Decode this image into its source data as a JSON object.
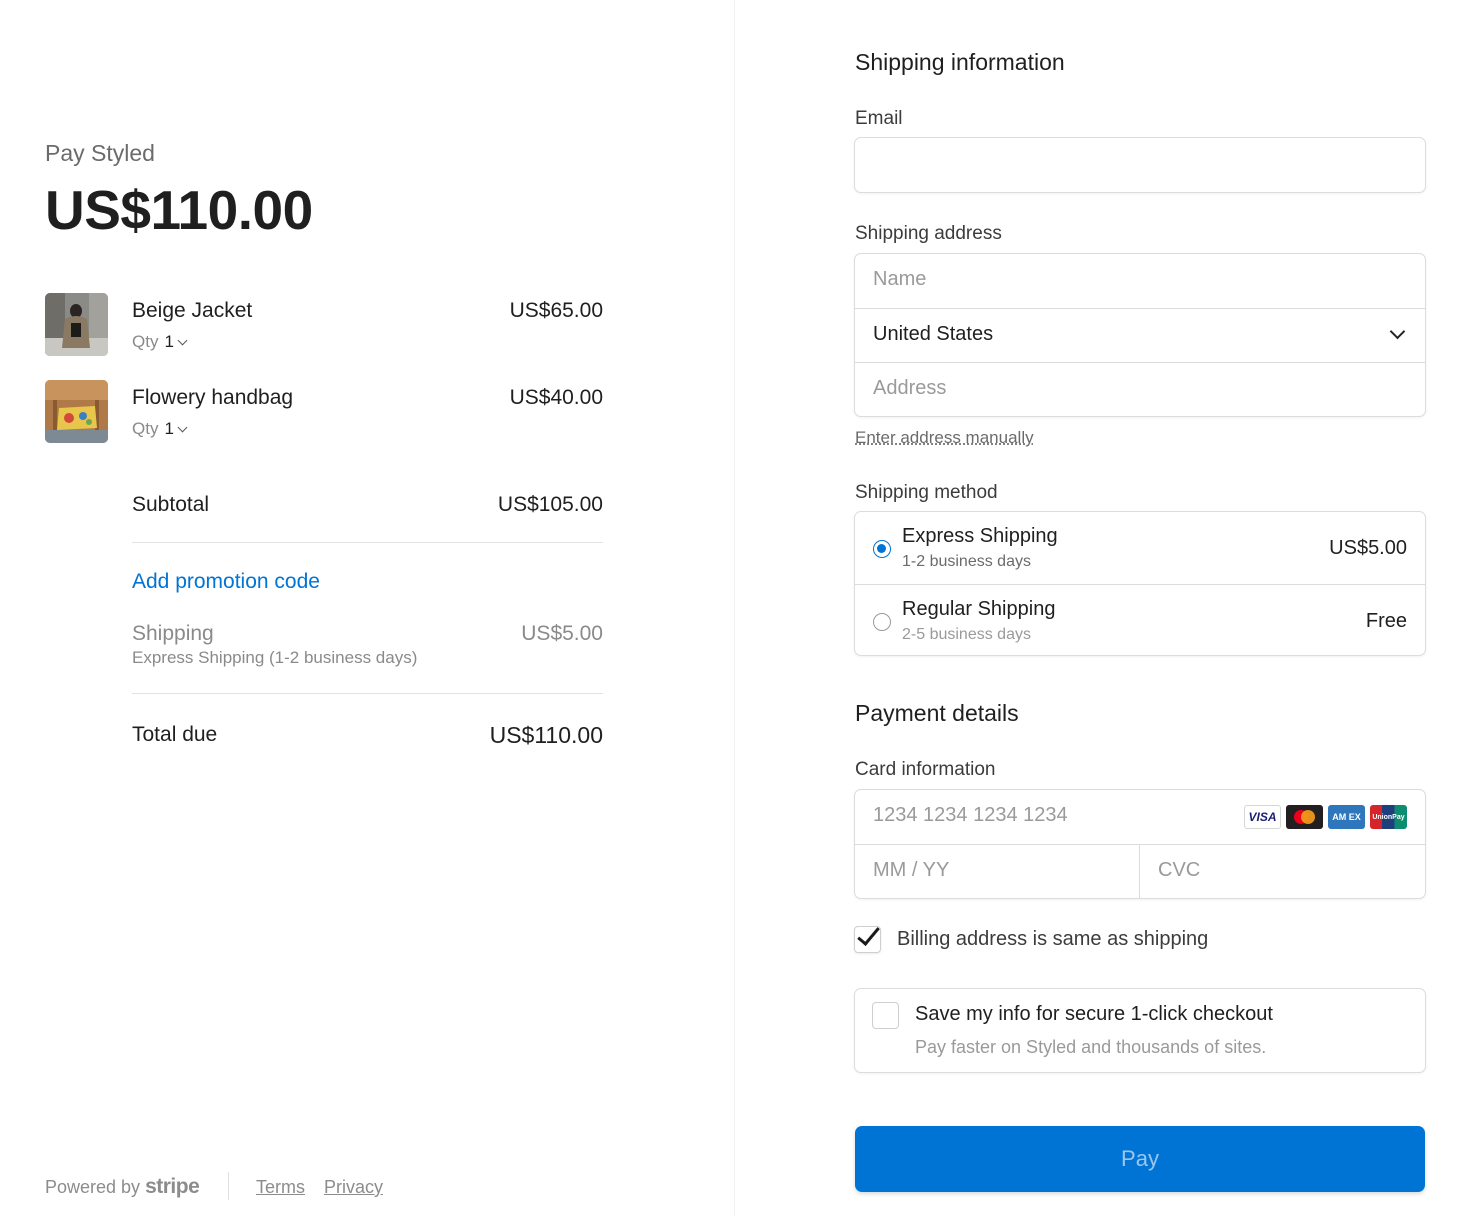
{
  "summary": {
    "merchant": "Pay Styled",
    "total": "US$110.00",
    "items": [
      {
        "name": "Beige Jacket",
        "qty_label": "Qty",
        "qty": "1",
        "price": "US$65.00"
      },
      {
        "name": "Flowery handbag",
        "qty_label": "Qty",
        "qty": "1",
        "price": "US$40.00"
      }
    ],
    "subtotal_label": "Subtotal",
    "subtotal": "US$105.00",
    "promo_label": "Add promotion code",
    "shipping_label": "Shipping",
    "shipping_detail": "Express Shipping (1-2 business days)",
    "shipping_value": "US$5.00",
    "total_due_label": "Total due",
    "total_due": "US$110.00"
  },
  "footer": {
    "powered_by": "Powered by",
    "brand": "stripe",
    "terms": "Terms",
    "privacy": "Privacy"
  },
  "shipping_info": {
    "heading": "Shipping information",
    "email_label": "Email",
    "email_value": "",
    "address_label": "Shipping address",
    "name_placeholder": "Name",
    "country": "United States",
    "address_placeholder": "Address",
    "manual_link": "Enter address manually"
  },
  "shipping_method": {
    "label": "Shipping method",
    "options": [
      {
        "title": "Express Shipping",
        "sub": "1-2 business days",
        "price": "US$5.00",
        "selected": true
      },
      {
        "title": "Regular Shipping",
        "sub": "2-5 business days",
        "price": "Free",
        "selected": false
      }
    ]
  },
  "payment": {
    "heading": "Payment details",
    "card_label": "Card information",
    "card_placeholder": "1234 1234 1234 1234",
    "expiry_placeholder": "MM / YY",
    "cvc_placeholder": "CVC",
    "card_brands": [
      "visa-icon",
      "mastercard-icon",
      "amex-icon",
      "unionpay-icon"
    ],
    "visa_text": "VISA",
    "amex_text": "AM EX",
    "unionpay_text": "UnionPay",
    "billing_same_label": "Billing address is same as shipping",
    "billing_same_checked": true,
    "save_title": "Save my info for secure 1-click checkout",
    "save_sub": "Pay faster on Styled and thousands of sites.",
    "pay_label": "Pay"
  },
  "colors": {
    "accent": "#0074d4",
    "pay_text": "#9cc6ee"
  }
}
